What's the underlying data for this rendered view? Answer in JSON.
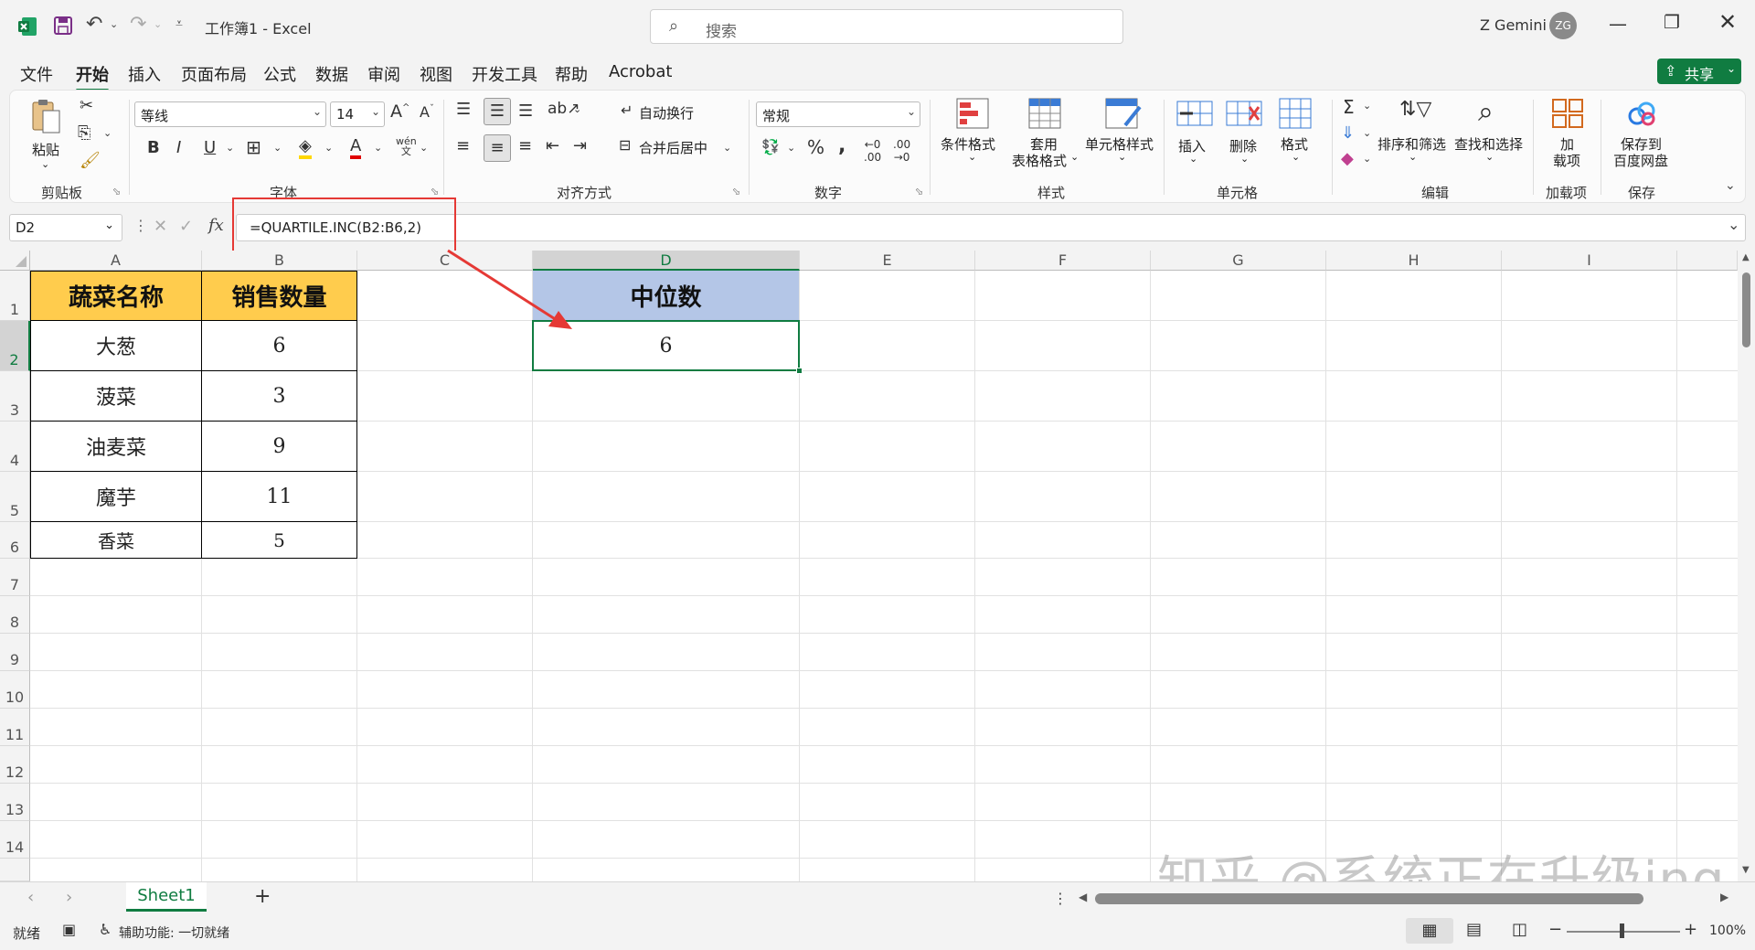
{
  "titlebar": {
    "document_title": "工作簿1 - Excel",
    "search_placeholder": "搜索",
    "user_name": "Z Gemini",
    "user_initials": "ZG"
  },
  "menu": {
    "items": [
      "文件",
      "开始",
      "插入",
      "页面布局",
      "公式",
      "数据",
      "审阅",
      "视图",
      "开发工具",
      "帮助",
      "Acrobat"
    ],
    "active": "开始",
    "share_label": "共享"
  },
  "ribbon": {
    "clipboard": {
      "paste_label": "粘贴",
      "group_label": "剪贴板"
    },
    "font": {
      "font_name": "等线",
      "font_size": "14",
      "group_label": "字体"
    },
    "alignment": {
      "wrap_label": "自动换行",
      "merge_label": "合并后居中",
      "group_label": "对齐方式"
    },
    "number": {
      "format": "常规",
      "group_label": "数字"
    },
    "styles": {
      "conditional": "条件格式",
      "table_fmt_1": "套用",
      "table_fmt_2": "表格格式",
      "cell_styles": "单元格样式",
      "group_label": "样式"
    },
    "cells": {
      "insert": "插入",
      "delete": "删除",
      "format": "格式",
      "group_label": "单元格"
    },
    "editing": {
      "sort_filter": "排序和筛选",
      "find_select": "查找和选择",
      "group_label": "编辑"
    },
    "addins": {
      "label_1": "加",
      "label_2": "载项",
      "group_label": "加载项"
    },
    "save": {
      "label_1": "保存到",
      "label_2": "百度网盘",
      "group_label": "保存"
    }
  },
  "formula_bar": {
    "name_box": "D2",
    "fx": "fx",
    "formula": "=QUARTILE.INC(B2:B6,2)"
  },
  "sheet": {
    "columns": [
      "A",
      "B",
      "C",
      "D",
      "E",
      "F",
      "G",
      "H",
      "I"
    ],
    "rows": [
      "1",
      "2",
      "3",
      "4",
      "5",
      "6",
      "7",
      "8",
      "9",
      "10",
      "11",
      "12",
      "13",
      "14"
    ],
    "selected_cell": "D2",
    "table_headers": [
      "蔬菜名称",
      "销售数量"
    ],
    "table_rows": [
      {
        "name": "大葱",
        "qty": "6"
      },
      {
        "name": "菠菜",
        "qty": "3"
      },
      {
        "name": "油麦菜",
        "qty": "9"
      },
      {
        "name": "魔芋",
        "qty": "11"
      },
      {
        "name": "香菜",
        "qty": "5"
      }
    ],
    "median_header": "中位数",
    "median_value": "6"
  },
  "tabs": {
    "sheet_name": "Sheet1",
    "add_label": "+"
  },
  "status": {
    "ready": "就绪",
    "accessibility": "辅助功能: 一切就绪",
    "zoom": "100%"
  },
  "watermark": "知乎 @系统正在升级ing",
  "colors": {
    "excel_green": "#107c41",
    "header_yellow": "#ffcc4d",
    "header_blue": "#b4c6e7",
    "annotation_red": "#e53935"
  }
}
